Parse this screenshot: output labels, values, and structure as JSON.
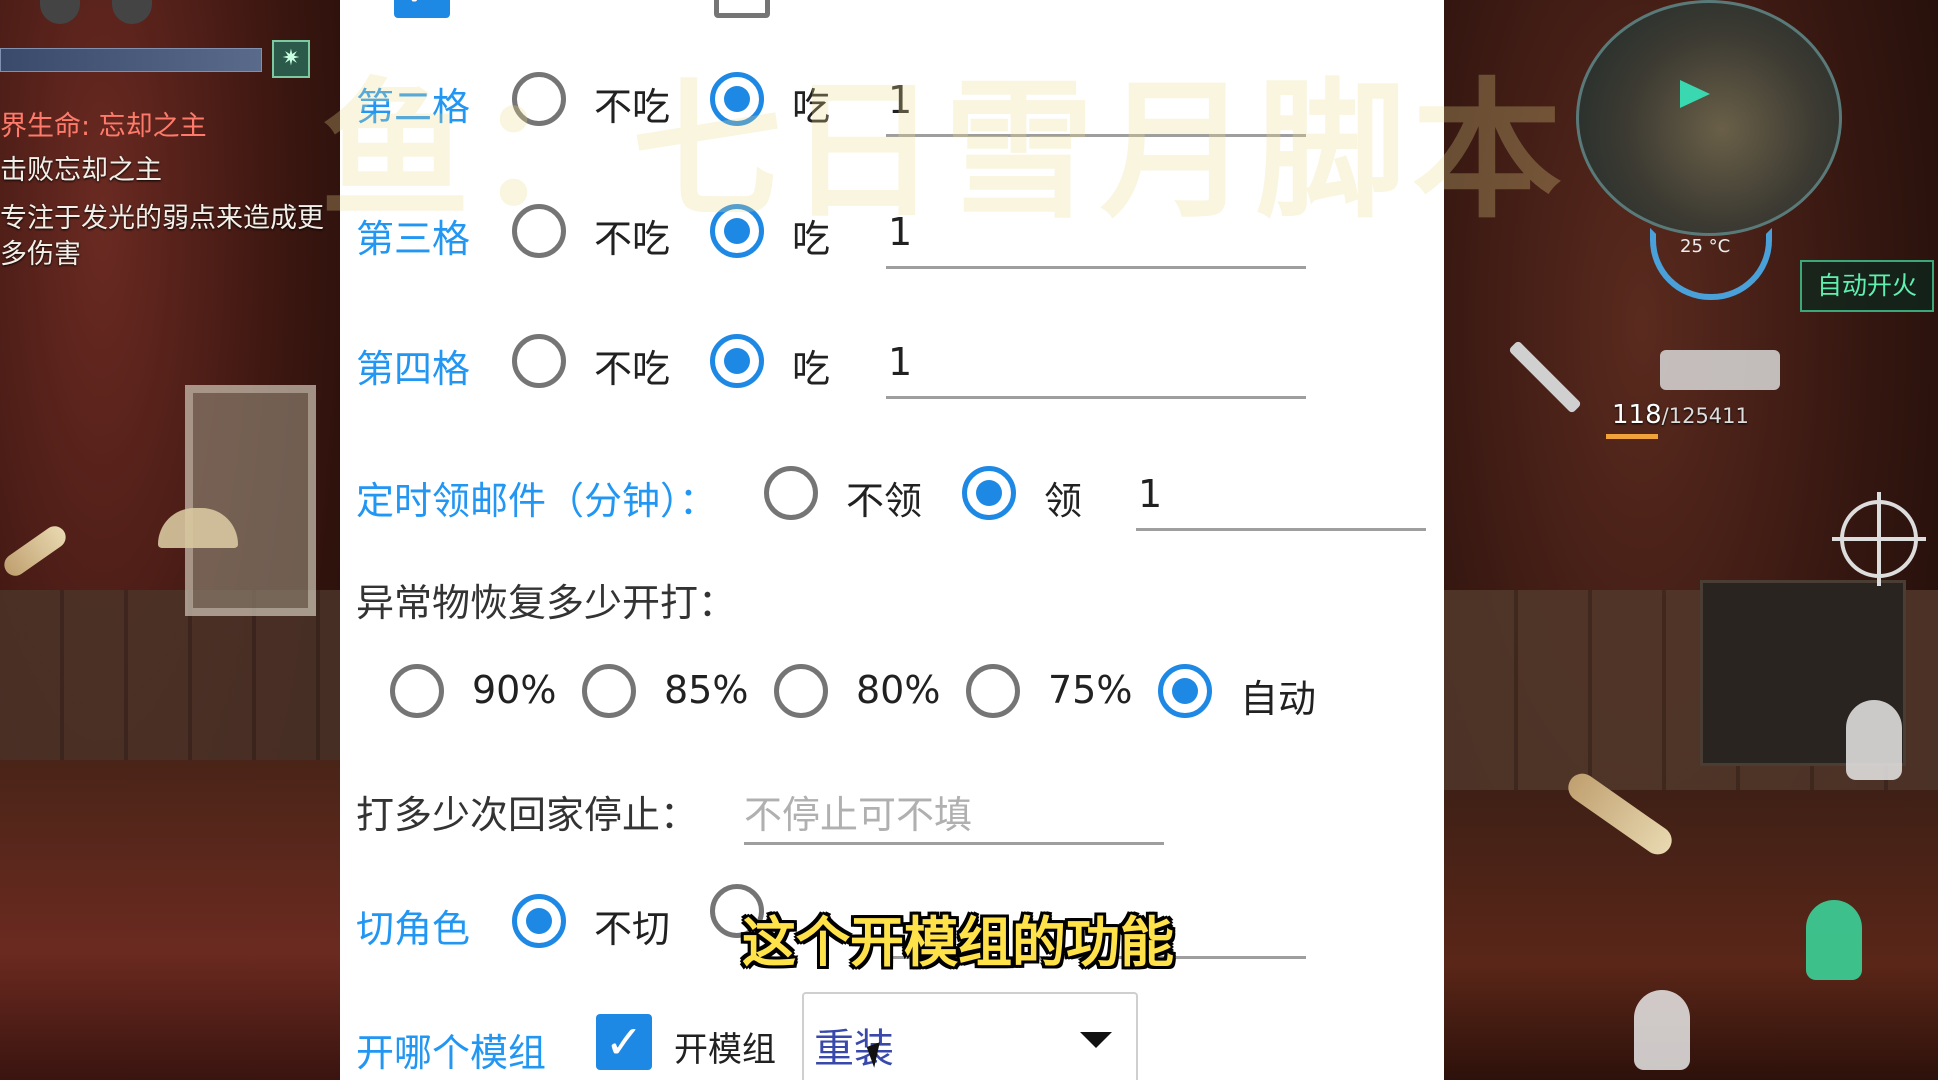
{
  "watermark": "鱼：七日雪月脚本",
  "game_hud": {
    "quest_title": "界生命: 忘却之主",
    "quest_lines": [
      "击败忘却之主",
      "专注于发光的弱点来造成更",
      "多伤害"
    ],
    "temperature": "25 °C",
    "auto_fire_label": "自动开火",
    "ammo_current": "118",
    "ammo_total": "/125411"
  },
  "settings": {
    "rows": [
      {
        "label": "第二格",
        "off_label": "不吃",
        "on_label": "吃",
        "selected": "on",
        "value": "1"
      },
      {
        "label": "第三格",
        "off_label": "不吃",
        "on_label": "吃",
        "selected": "on",
        "value": "1"
      },
      {
        "label": "第四格",
        "off_label": "不吃",
        "on_label": "吃",
        "selected": "on",
        "value": "1"
      }
    ],
    "mail": {
      "label": "定时领邮件（分钟）：",
      "off_label": "不领",
      "on_label": "领",
      "selected": "on",
      "value": "1"
    },
    "recover": {
      "label": "异常物恢复多少开打：",
      "options": [
        "90%",
        "85%",
        "80%",
        "75%",
        "自动"
      ],
      "selected": "自动"
    },
    "stop": {
      "label": "打多少次回家停止：",
      "placeholder": "不停止可不填",
      "value": ""
    },
    "switch_role": {
      "label": "切角色",
      "off_label": "不切",
      "selected": "off"
    },
    "module": {
      "label": "开哪个模组",
      "checkbox_label": "开模组",
      "checked": true,
      "selected_option": "重装"
    }
  },
  "subtitle": "这个开模组的功能",
  "colors": {
    "accent": "#1e88e5",
    "label_blue": "#2196f3",
    "subtitle": "#ffe24a"
  }
}
